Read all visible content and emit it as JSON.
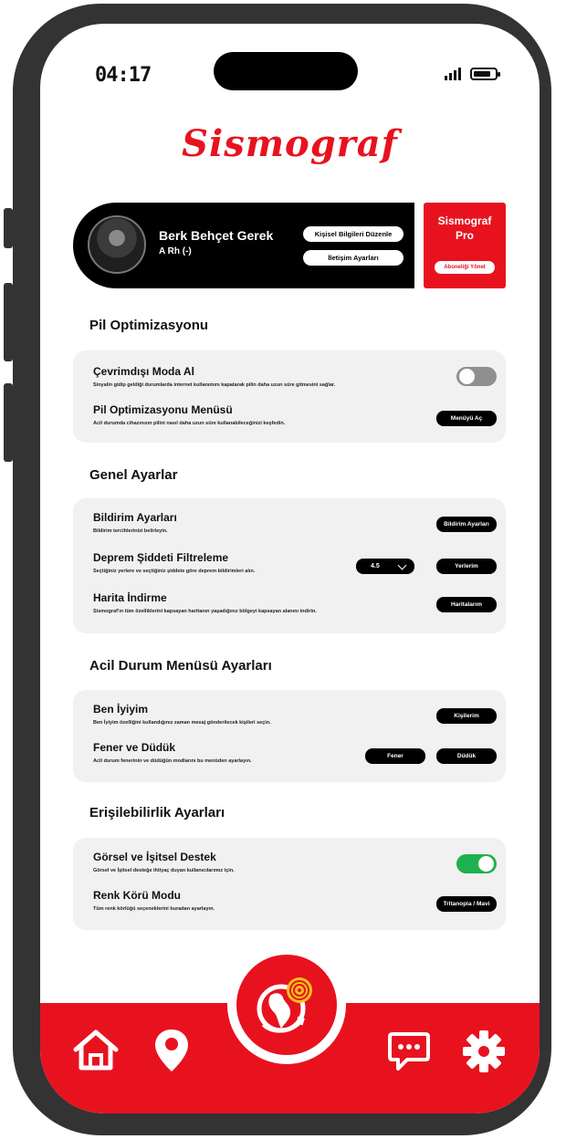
{
  "status_bar": {
    "time": "04:17"
  },
  "app": {
    "title": "Sismograf"
  },
  "profile": {
    "name": "Berk Behçet Gerek",
    "blood_type": "A Rh (-)",
    "edit_button": "Kişisel Bilgileri Düzenle",
    "contact_button": "İletişim Ayarları"
  },
  "pro": {
    "title_line1": "Sismograf",
    "title_line2": "Pro",
    "subscription_button": "Aboneliği Yönet"
  },
  "battery_section": {
    "title": "Pil Optimizasyonu",
    "offline": {
      "title": "Çevrimdışı Moda Al",
      "desc": "Sinyalin gidip geldiği durumlarda internet kullanımını kapatarak pilin daha uzun süre gitmesini sağlar.",
      "enabled": false
    },
    "menu": {
      "title": "Pil Optimizasyonu Menüsü",
      "desc": "Acil durumda cihazınızın pilini nasıl daha uzun süre kullanabileceğinizi keşfedin.",
      "button": "Menüyü Aç"
    }
  },
  "general_section": {
    "title": "Genel Ayarlar",
    "notifications": {
      "title": "Bildirim Ayarları",
      "desc": "Bildirim tercihlerinizi belirleyin.",
      "button": "Bildirim Ayarları"
    },
    "intensity": {
      "title": "Deprem Şiddeti Filtreleme",
      "desc": "Seçtiğiniz yerlere ve seçtiğiniz şiddete göre deprem bildirimleri alın.",
      "selected_value": "4.5",
      "button": "Yerlerim"
    },
    "map": {
      "title": "Harita İndirme",
      "desc": "Sismograf'ın tüm özelliklerini kapsayan haritanın yaşadığınız bölgeyi kapsayan alanını indirin.",
      "button": "Haritalarım"
    }
  },
  "emergency_section": {
    "title": "Acil Durum Menüsü Ayarları",
    "im_ok": {
      "title": "Ben İyiyim",
      "desc": "Ben İyiyim özelliğini kullandığınız zaman mesaj gönderilecek kişileri seçin.",
      "button": "Kişilerim"
    },
    "flashlight": {
      "title": "Fener ve Düdük",
      "desc": "Acil durum fenerinin ve düdüğün modlarını bu menüden ayarlayın.",
      "button_flashlight": "Fener",
      "button_whistle": "Düdük"
    }
  },
  "accessibility_section": {
    "title": "Erişilebilirlik Ayarları",
    "audiovisual": {
      "title": "Görsel ve İşitsel Destek",
      "desc": "Görsel ve İşitsel desteğe ihtiyaç duyan kullanıcılarımız için.",
      "enabled": true
    },
    "colorblind": {
      "title": "Renk Körü Modu",
      "desc": "Tüm renk körlüğü seçeneklerini buradan ayarlayın.",
      "button": "Tritanopia / Mavi"
    }
  },
  "nav": {
    "items": [
      "home-icon",
      "location-pin-icon",
      "earthquake-globe-icon",
      "chat-bubble-icon",
      "gear-icon"
    ],
    "accent_color": "#e8121f"
  }
}
